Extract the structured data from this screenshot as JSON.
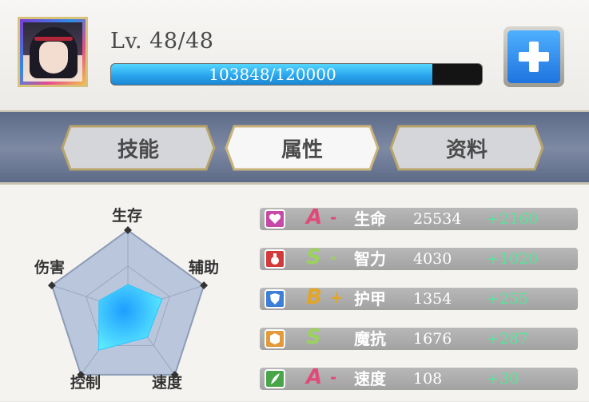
{
  "hero": {
    "level_text": "Lv. 48/48",
    "xp_text": "103848/120000",
    "xp_current": 103848,
    "xp_max": 120000
  },
  "tabs": [
    {
      "label": "技能",
      "active": false
    },
    {
      "label": "属性",
      "active": true
    },
    {
      "label": "资料",
      "active": false
    }
  ],
  "radar": {
    "axes": [
      "生存",
      "辅助",
      "速度",
      "控制",
      "伤害"
    ],
    "values": [
      0.32,
      0.45,
      0.42,
      0.62,
      0.38
    ],
    "fill_color": "#29c6ff"
  },
  "stats": [
    {
      "grade": "A",
      "mod": "-",
      "name": "生命",
      "value": "25534",
      "bonus": "+2160",
      "icon": "heart-icon",
      "icon_color": "#c54aa8",
      "grade_color": "#e04a7a"
    },
    {
      "grade": "S",
      "mod": "-",
      "name": "智力",
      "value": "4030",
      "bonus": "+1020",
      "icon": "potion-icon",
      "icon_color": "#d23b3b",
      "grade_color": "#9ad35a"
    },
    {
      "grade": "B",
      "mod": "+",
      "name": "护甲",
      "value": "1354",
      "bonus": "+255",
      "icon": "shield-icon",
      "icon_color": "#3d7fd6",
      "grade_color": "#e2a526"
    },
    {
      "grade": "S",
      "mod": "",
      "name": "魔抗",
      "value": "1676",
      "bonus": "+287",
      "icon": "hex-shield-icon",
      "icon_color": "#e29a3a",
      "grade_color": "#9ad35a"
    },
    {
      "grade": "A",
      "mod": "-",
      "name": "速度",
      "value": "108",
      "bonus": "+30",
      "icon": "feather-icon",
      "icon_color": "#4aa54a",
      "grade_color": "#e04a7a"
    }
  ]
}
